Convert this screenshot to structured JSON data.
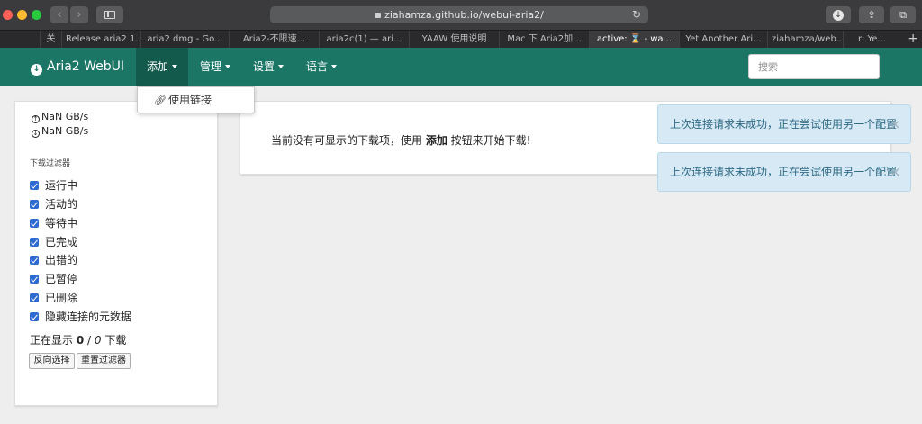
{
  "browser": {
    "url": "ziahamza.github.io/webui-aria2/",
    "back_glyph": "‹",
    "forward_glyph": "›",
    "reload_glyph": "↻",
    "share_glyph": "⇪",
    "tabs_glyph": "⧉",
    "download_glyph": "↓",
    "new_tab_glyph": "+",
    "tabs": [
      {
        "label": "关"
      },
      {
        "label": "Release aria2 1..."
      },
      {
        "label": "aria2 dmg - Go..."
      },
      {
        "label": "Aria2-不限速..."
      },
      {
        "label": "aria2c(1) — ari..."
      },
      {
        "label": "YAAW 使用说明"
      },
      {
        "label": "Mac 下 Aria2加..."
      },
      {
        "label": "active: ⌛ - wa..."
      },
      {
        "label": "Yet Another Ari..."
      },
      {
        "label": "ziahamza/web..."
      },
      {
        "label": "r: Ye..."
      }
    ]
  },
  "navbar": {
    "brand": "Aria2 WebUI",
    "brand_icon": "download-circle-icon",
    "items": {
      "add": "添加",
      "manage": "管理",
      "settings": "设置",
      "language": "语言"
    },
    "search_placeholder": "搜索"
  },
  "add_menu": {
    "items": [
      {
        "label": "使用链接",
        "icon": "link-icon"
      }
    ]
  },
  "sidebar": {
    "upload_speed": "NaN GB/s",
    "download_speed": "NaN GB/s",
    "filter_heading": "下载过滤器",
    "filters": [
      {
        "label": "运行中",
        "checked": true
      },
      {
        "label": "活动的",
        "checked": true
      },
      {
        "label": "等待中",
        "checked": true
      },
      {
        "label": "已完成",
        "checked": true
      },
      {
        "label": "出错的",
        "checked": true
      },
      {
        "label": "已暂停",
        "checked": true
      },
      {
        "label": "已删除",
        "checked": true
      },
      {
        "label": "隐藏连接的元数据",
        "checked": true
      }
    ],
    "showing": {
      "prefix": "正在显示 ",
      "shown": "0",
      "separator": " / ",
      "total": "0",
      "suffix": " 下载"
    },
    "invert_button": "反向选择",
    "reset_button": "重置过滤器"
  },
  "main": {
    "empty_prefix": "当前没有可显示的下载项，使用 ",
    "empty_bold": "添加",
    "empty_suffix": " 按钮来开始下载!"
  },
  "alerts": [
    {
      "text": "上次连接请求未成功，正在尝试使用另一个配置",
      "close": "×"
    },
    {
      "text": "上次连接请求未成功，正在尝试使用另一个配置",
      "close": "×"
    }
  ],
  "colors": {
    "navbar": "#1b7666",
    "navbar_active": "#135a4d",
    "checkbox": "#2f6ad0",
    "alert_bg": "#d6e9f4",
    "alert_text": "#2f6a86"
  }
}
